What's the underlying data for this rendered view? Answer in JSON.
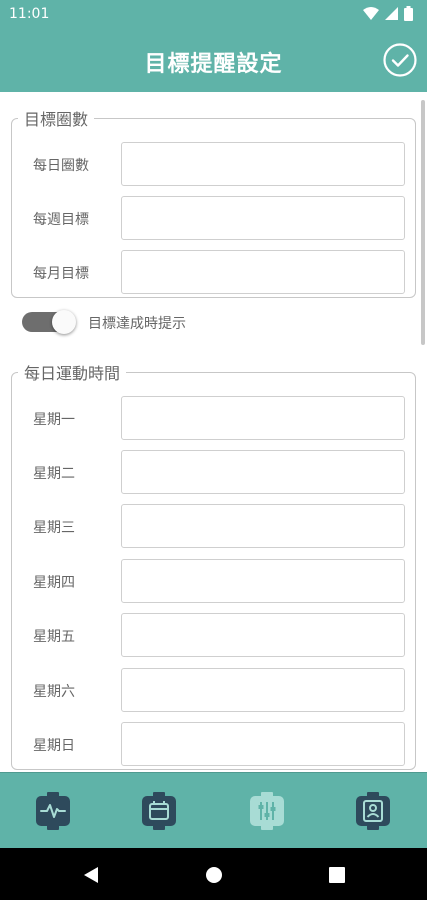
{
  "status_bar": {
    "time": "11:01"
  },
  "app_bar": {
    "title": "目標提醒設定",
    "confirm_icon": "check-circle-icon"
  },
  "daily_laps_group": {
    "legend": "目標圈數",
    "rows": [
      {
        "label": "每日圈數",
        "value": ""
      },
      {
        "label": "每週目標",
        "value": ""
      },
      {
        "label": "每月目標",
        "value": ""
      }
    ]
  },
  "goal_toggle": {
    "label": "目標達成時提示",
    "on": true
  },
  "exercise_time_group": {
    "legend": "每日運動時間",
    "rows": [
      {
        "label": "星期一",
        "value": ""
      },
      {
        "label": "星期二",
        "value": ""
      },
      {
        "label": "星期三",
        "value": ""
      },
      {
        "label": "星期四",
        "value": ""
      },
      {
        "label": "星期五",
        "value": ""
      },
      {
        "label": "星期六",
        "value": ""
      },
      {
        "label": "星期日",
        "value": ""
      }
    ]
  },
  "bottom_nav": {
    "items": [
      {
        "icon": "heart-rate-watch-icon",
        "active": false
      },
      {
        "icon": "calendar-watch-icon",
        "active": false
      },
      {
        "icon": "settings-sliders-watch-icon",
        "active": true
      },
      {
        "icon": "profile-watch-icon",
        "active": false
      }
    ]
  },
  "colors": {
    "primary": "#5FB3A8",
    "nav_icon": "#2E4A5C",
    "nav_icon_active": "#A8DCD5"
  }
}
